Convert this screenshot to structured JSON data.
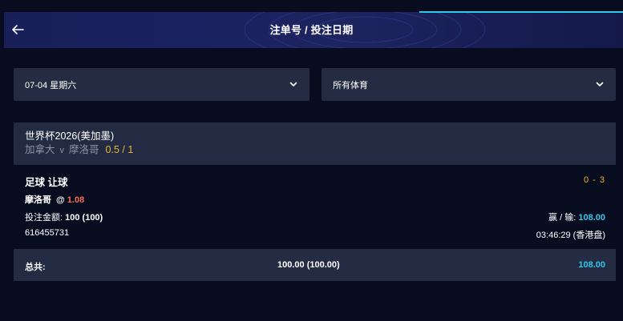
{
  "header": {
    "title": "注单号 / 投注日期",
    "back_icon": "arrow-left-icon"
  },
  "filters": {
    "date": {
      "selected": "07-04 星期六",
      "icon": "chevron-down-icon"
    },
    "sport": {
      "selected": "所有体育",
      "icon": "chevron-down-icon"
    }
  },
  "bet": {
    "league": "世界杯2026(美加墨)",
    "home_team": "加拿大",
    "vs": "v",
    "away_team": "摩洛哥",
    "handicap": "0.5 / 1",
    "bet_type": "足球 让球",
    "score": "0 - 3",
    "selection": "摩洛哥",
    "odds_prefix": "@",
    "odds": "1.08",
    "stake_label": "投注金额:",
    "stake_value": "100 (100)",
    "winloss_label": "赢 / 输:",
    "winloss_value": "108.00",
    "ticket_id": "616455731",
    "time": "03:46:29 (香港盘)"
  },
  "total": {
    "label": "总共:",
    "stake": "100.00 (100.00)",
    "win": "108.00"
  },
  "colors": {
    "background": "#070d1f",
    "panel": "#232c42",
    "accent_cyan": "#34c6e8",
    "accent_gold": "#f0b429",
    "odds_red": "#f56a52"
  }
}
